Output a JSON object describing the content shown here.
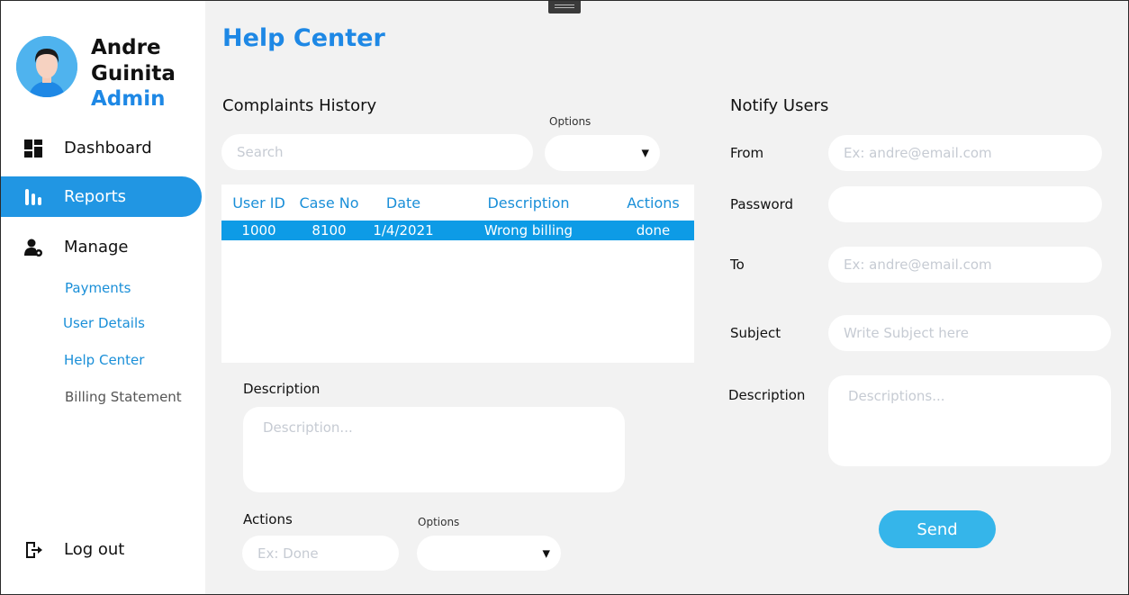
{
  "profile": {
    "first_name": "Andre",
    "last_name": "Guinita",
    "role": "Admin"
  },
  "nav": {
    "dashboard": "Dashboard",
    "reports": "Reports",
    "manage": "Manage",
    "payments": "Payments",
    "user_details": "User Details",
    "help_center": "Help Center",
    "billing_statement": "Billing Statement",
    "logout": "Log out"
  },
  "page": {
    "title": "Help Center"
  },
  "complaints": {
    "title": "Complaints History",
    "options_label": "Options",
    "search_placeholder": "Search",
    "columns": [
      "User ID",
      "Case No",
      "Date",
      "Description",
      "Actions"
    ],
    "rows": [
      [
        "1000",
        "8100",
        "1/4/2021",
        "Wrong billing",
        "done"
      ]
    ],
    "description_label": "Description",
    "description_placeholder": "Description...",
    "actions_label": "Actions",
    "actions_placeholder": "Ex: Done",
    "actions_options_label": "Options"
  },
  "notify": {
    "title": "Notify Users",
    "from_label": "From",
    "from_placeholder": "Ex: andre@email.com",
    "password_label": "Password",
    "to_label": "To",
    "to_placeholder": "Ex: andre@email.com",
    "subject_label": "Subject",
    "subject_placeholder": "Write Subject here",
    "description_label": "Description",
    "description_placeholder": "Descriptions...",
    "send_label": "Send"
  },
  "colors": {
    "accent": "#1e88e5",
    "active_nav": "#2196e3",
    "selected_row": "#0d9be6",
    "send_button": "#35b5ea"
  }
}
